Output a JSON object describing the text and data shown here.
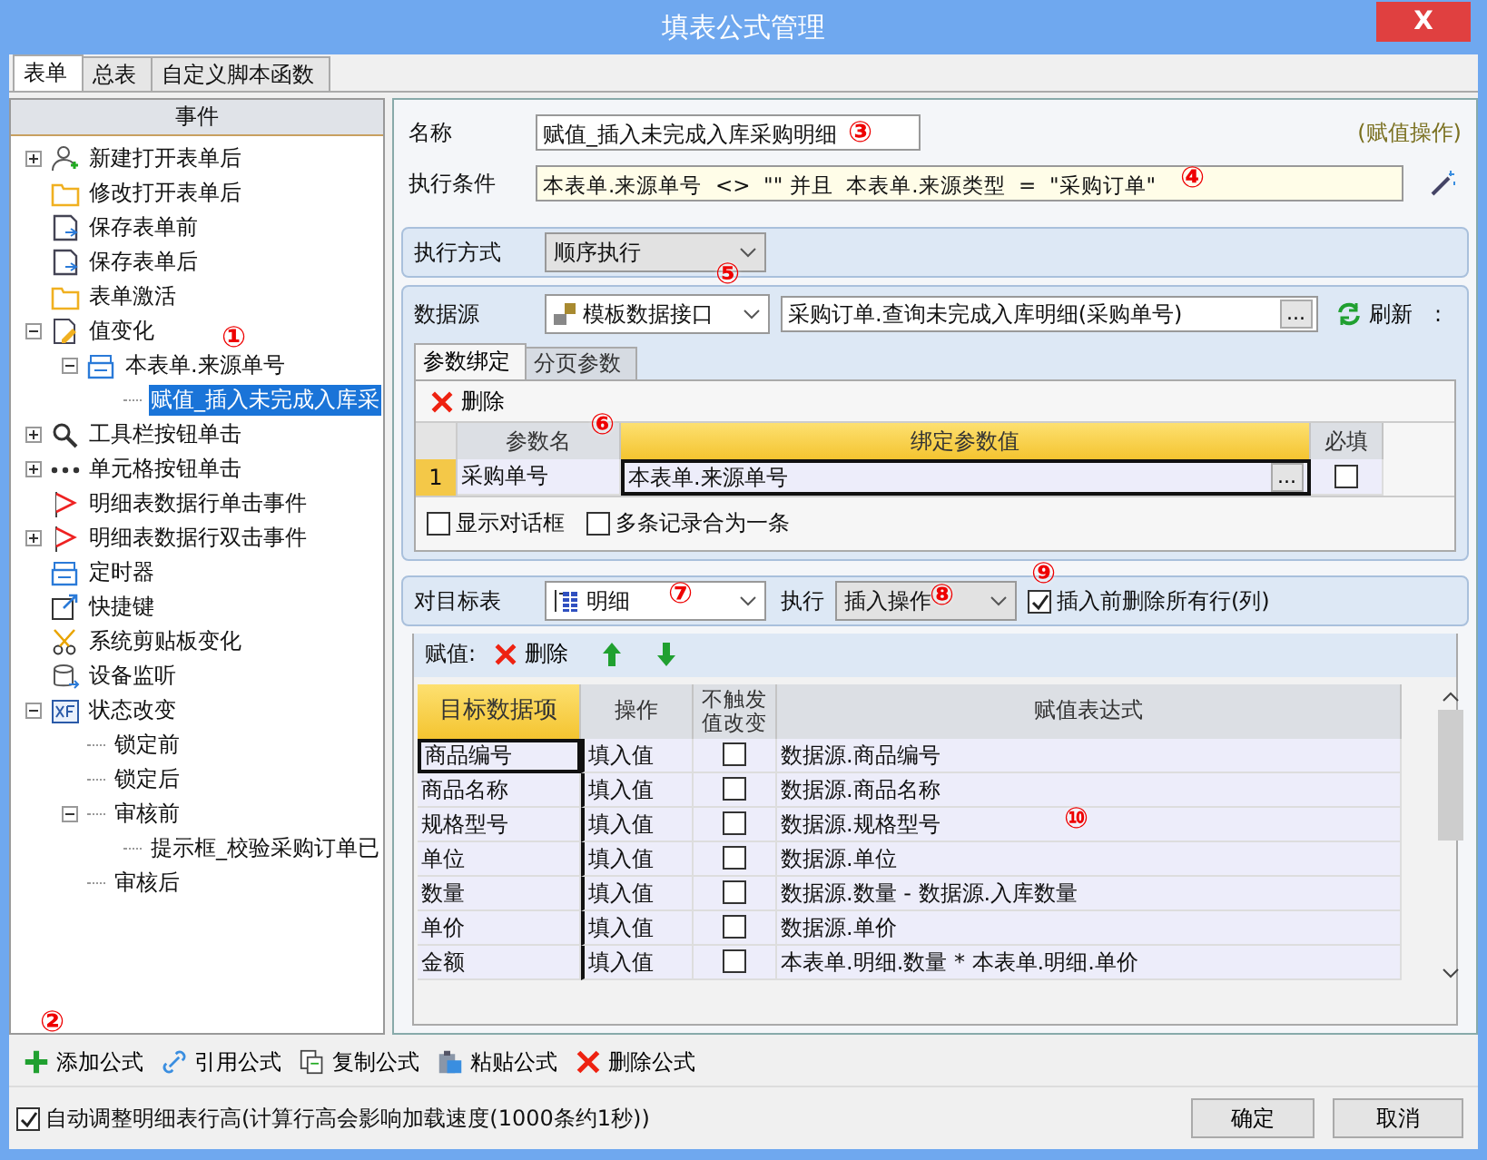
{
  "window": {
    "title": "填表公式管理",
    "close": "X"
  },
  "tabs": [
    {
      "label": "表单",
      "selected": true
    },
    {
      "label": "总表",
      "selected": false
    },
    {
      "label": "自定义脚本函数",
      "selected": false
    }
  ],
  "events": {
    "header": "事件",
    "tree": [
      {
        "label": "新建打开表单后",
        "kind": "person",
        "expanded": false,
        "selected": false
      },
      {
        "label": "修改打开表单后",
        "kind": "folder",
        "selected": false
      },
      {
        "label": "保存表单前",
        "kind": "save",
        "selected": false
      },
      {
        "label": "保存表单后",
        "kind": "save",
        "selected": false
      },
      {
        "label": "表单激活",
        "kind": "folder",
        "selected": false
      },
      {
        "label": "值变化",
        "kind": "edit",
        "expanded": true,
        "selected": false,
        "children": [
          {
            "label": "本表单.来源单号",
            "kind": "table",
            "expanded": true,
            "selected": false,
            "children": [
              {
                "label": "赋值_插入未完成入库采",
                "selected": true
              }
            ]
          }
        ]
      },
      {
        "label": "工具栏按钮单击",
        "kind": "tool",
        "expanded": false,
        "selected": false
      },
      {
        "label": "单元格按钮单击",
        "kind": "dots",
        "expanded": false,
        "selected": false
      },
      {
        "label": "明细表数据行单击事件",
        "kind": "flag",
        "selected": false
      },
      {
        "label": "明细表数据行双击事件",
        "kind": "flag",
        "expanded": false,
        "selected": false
      },
      {
        "label": "定时器",
        "kind": "table",
        "selected": false
      },
      {
        "label": "快捷键",
        "kind": "shortcut",
        "selected": false
      },
      {
        "label": "系统剪贴板变化",
        "kind": "scissors",
        "selected": false
      },
      {
        "label": "设备监听",
        "kind": "device",
        "selected": false
      },
      {
        "label": "状态改变",
        "kind": "state",
        "expanded": true,
        "selected": false,
        "children": [
          {
            "label": "锁定前",
            "selected": false
          },
          {
            "label": "锁定后",
            "selected": false
          },
          {
            "label": "审核前",
            "expanded": true,
            "selected": false,
            "children": [
              {
                "label": "提示框_校验采购订单已",
                "selected": false
              }
            ]
          },
          {
            "label": "审核后",
            "selected": false
          }
        ]
      }
    ]
  },
  "formula": {
    "name_label": "名称",
    "name": "赋值_插入未完成入库采购明细",
    "type_note": "(赋值操作)",
    "condition_label": "执行条件",
    "condition": "本表单.来源单号  <>  \"\" 并且  本表单.来源类型  =  \"采购订单\""
  },
  "mode": {
    "label": "执行方式",
    "value": "顺序执行"
  },
  "datasource": {
    "label": "数据源",
    "type": "模板数据接口",
    "query": "采购订单.查询未完成入库明细(采购单号)",
    "browse": "...",
    "refresh": "刷新",
    "more": ":"
  },
  "param_tabs": [
    {
      "label": "参数绑定",
      "selected": true
    },
    {
      "label": "分页参数",
      "selected": false
    }
  ],
  "param_toolbar": {
    "delete": "删除"
  },
  "param_table": {
    "columns": [
      {
        "label": "参数名",
        "highlighted": false
      },
      {
        "label": "绑定参数值",
        "highlighted": true
      },
      {
        "label": "必填",
        "highlighted": false
      }
    ],
    "rows": [
      {
        "index": "1",
        "name": "采购单号",
        "value": "本表单.来源单号",
        "browse": "...",
        "required": false
      }
    ]
  },
  "param_options": [
    {
      "label": "显示对话框",
      "checked": false
    },
    {
      "label": "多条记录合为一条",
      "checked": false
    }
  ],
  "target": {
    "label": "对目标表",
    "table": "明细",
    "exec_label": "执行",
    "exec": "插入操作",
    "clear_first": {
      "label": "插入前删除所有行(列)",
      "checked": true
    }
  },
  "assign_toolbar": {
    "label": "赋值:",
    "delete": "删除"
  },
  "assign_table": {
    "columns": [
      {
        "label": "目标数据项",
        "highlighted": true
      },
      {
        "label": "操作",
        "highlighted": false
      },
      {
        "label": "不触发值改变",
        "highlighted": false
      },
      {
        "label": "赋值表达式",
        "highlighted": false
      }
    ],
    "rows": [
      {
        "target": "商品编号",
        "op": "填入值",
        "no_trigger": false,
        "expr": "数据源.商品编号",
        "current": true
      },
      {
        "target": "商品名称",
        "op": "填入值",
        "no_trigger": false,
        "expr": "数据源.商品名称",
        "current": false
      },
      {
        "target": "规格型号",
        "op": "填入值",
        "no_trigger": false,
        "expr": "数据源.规格型号",
        "current": false
      },
      {
        "target": "单位",
        "op": "填入值",
        "no_trigger": false,
        "expr": "数据源.单位",
        "current": false
      },
      {
        "target": "数量",
        "op": "填入值",
        "no_trigger": false,
        "expr": "数据源.数量  -  数据源.入库数量",
        "current": false
      },
      {
        "target": "单价",
        "op": "填入值",
        "no_trigger": false,
        "expr": "数据源.单价",
        "current": false
      },
      {
        "target": "金额",
        "op": "填入值",
        "no_trigger": false,
        "expr": "本表单.明细.数量  *  本表单.明细.单价",
        "current": false
      }
    ]
  },
  "actions": [
    {
      "kind": "add",
      "label": "添加公式"
    },
    {
      "kind": "link",
      "label": "引用公式"
    },
    {
      "kind": "copy",
      "label": "复制公式"
    },
    {
      "kind": "paste",
      "label": "粘贴公式"
    },
    {
      "kind": "delete",
      "label": "删除公式"
    }
  ],
  "auto_height": {
    "label": "自动调整明细表行高(计算行高会影响加载速度(1000条约1秒))",
    "checked": true
  },
  "buttons": [
    "确定",
    "取消"
  ],
  "annotations": [
    "①",
    "②",
    "③",
    "④",
    "⑤",
    "⑥",
    "⑦",
    "⑧",
    "⑨",
    "⑩"
  ]
}
